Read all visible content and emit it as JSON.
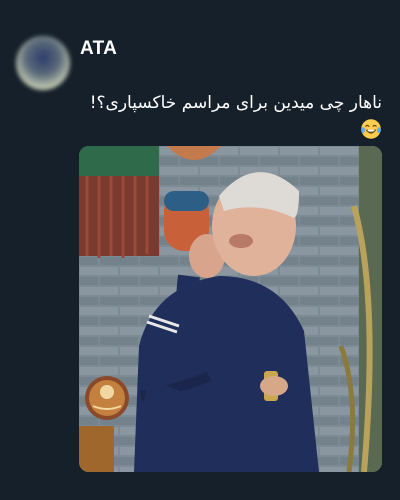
{
  "tweet": {
    "author_name": "ATA",
    "text_line1": "ناهار چی میدین برای مراسم خاکسپاری؟!",
    "emoji_icon": "face-with-tears-of-joy",
    "media_alt": "photo"
  },
  "colors": {
    "background": "#15202b",
    "text": "#ffffff"
  }
}
